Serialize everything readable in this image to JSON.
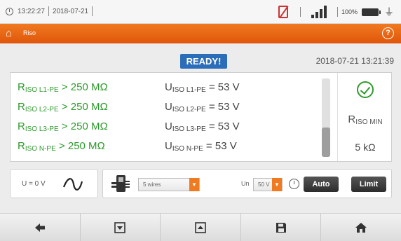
{
  "status": {
    "time": "13:22:27",
    "date": "2018-07-21",
    "battery": "100%"
  },
  "header": {
    "title": "Riso",
    "help": "?"
  },
  "ready": "READY!",
  "timestamp": "2018-07-21 13:21:39",
  "results": [
    {
      "r_main": "R",
      "r_sub": "ISO L1-PE",
      "r_value": "> 250 MΩ",
      "u_main": "U",
      "u_sub": "ISO L1-PE",
      "u_value": "= 53 V"
    },
    {
      "r_main": "R",
      "r_sub": "ISO L2-PE",
      "r_value": "> 250 MΩ",
      "u_main": "U",
      "u_sub": "ISO L2-PE",
      "u_value": "= 53 V"
    },
    {
      "r_main": "R",
      "r_sub": "ISO L3-PE",
      "r_value": "> 250 MΩ",
      "u_main": "U",
      "u_sub": "ISO L3-PE",
      "u_value": "= 53 V"
    },
    {
      "r_main": "R",
      "r_sub": "ISO N-PE",
      "r_value": "> 250 MΩ",
      "u_main": "U",
      "u_sub": "ISO N-PE",
      "u_value": "= 53 V"
    }
  ],
  "rmin": {
    "main": "R",
    "sub": "ISO MIN",
    "value": "5 kΩ"
  },
  "params": {
    "voltage": "U = 0 V",
    "wires_value": "5 wires",
    "un_label": "Un",
    "un_value": "50 V",
    "auto_label": "Auto",
    "limit_label": "Limit"
  },
  "colors": {
    "accent": "#e8650f",
    "pass": "#2e9a2e",
    "ready": "#2b6db8"
  },
  "nav_icons": [
    "arrow-left-icon",
    "download-icon",
    "upload-icon",
    "save-icon",
    "home-icon"
  ]
}
